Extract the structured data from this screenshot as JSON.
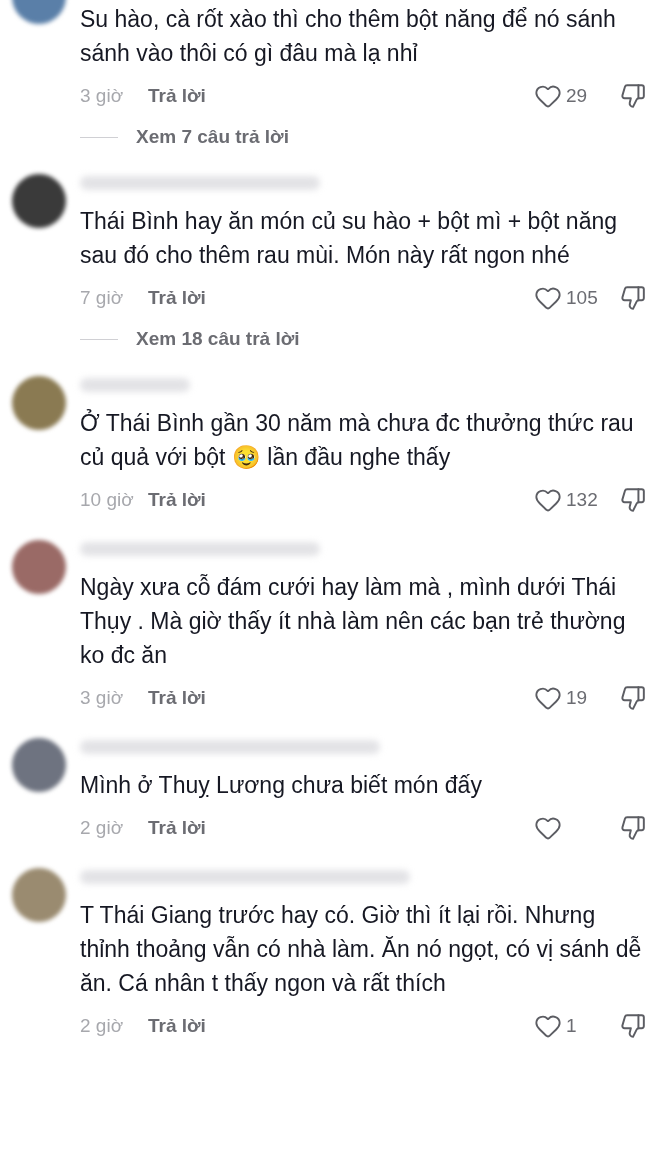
{
  "comments": [
    {
      "text": "Su hào, cà rốt xào thì cho thêm bột năng để nó sánh sánh vào thôi có gì đâu mà lạ nhỉ",
      "time": "3 giờ",
      "reply": "Trả lời",
      "likes": "29",
      "view_replies": "Xem 7 câu trả lời"
    },
    {
      "text": "Thái Bình hay ăn món củ su hào + bột mì + bột năng sau đó cho thêm rau mùi. Món này rất ngon nhé",
      "time": "7 giờ",
      "reply": "Trả lời",
      "likes": "105",
      "view_replies": "Xem 18 câu trả lời"
    },
    {
      "text": "Ở Thái Bình gần 30 năm mà chưa đc thưởng thức rau củ quả với bột 🥹 lần đầu nghe thấy",
      "time": "10 giờ",
      "reply": "Trả lời",
      "likes": "132"
    },
    {
      "text": "Ngày xưa cỗ đám cưới hay làm mà , mình dưới Thái Thụy . Mà giờ thấy ít nhà làm nên các bạn trẻ thường ko đc ăn",
      "time": "3 giờ",
      "reply": "Trả lời",
      "likes": "19"
    },
    {
      "text": "Mình ở Thuỵ Lương chưa biết món đấy",
      "time": "2 giờ",
      "reply": "Trả lời"
    },
    {
      "text": "T Thái Giang trước hay có. Giờ thì ít lại rồi. Nhưng thỉnh thoảng vẫn có nhà làm. Ăn nó ngọt, có vị sánh dễ ăn. Cá nhân t thấy ngon và rất thích",
      "time": "2 giờ",
      "reply": "Trả lời",
      "likes": "1"
    }
  ]
}
